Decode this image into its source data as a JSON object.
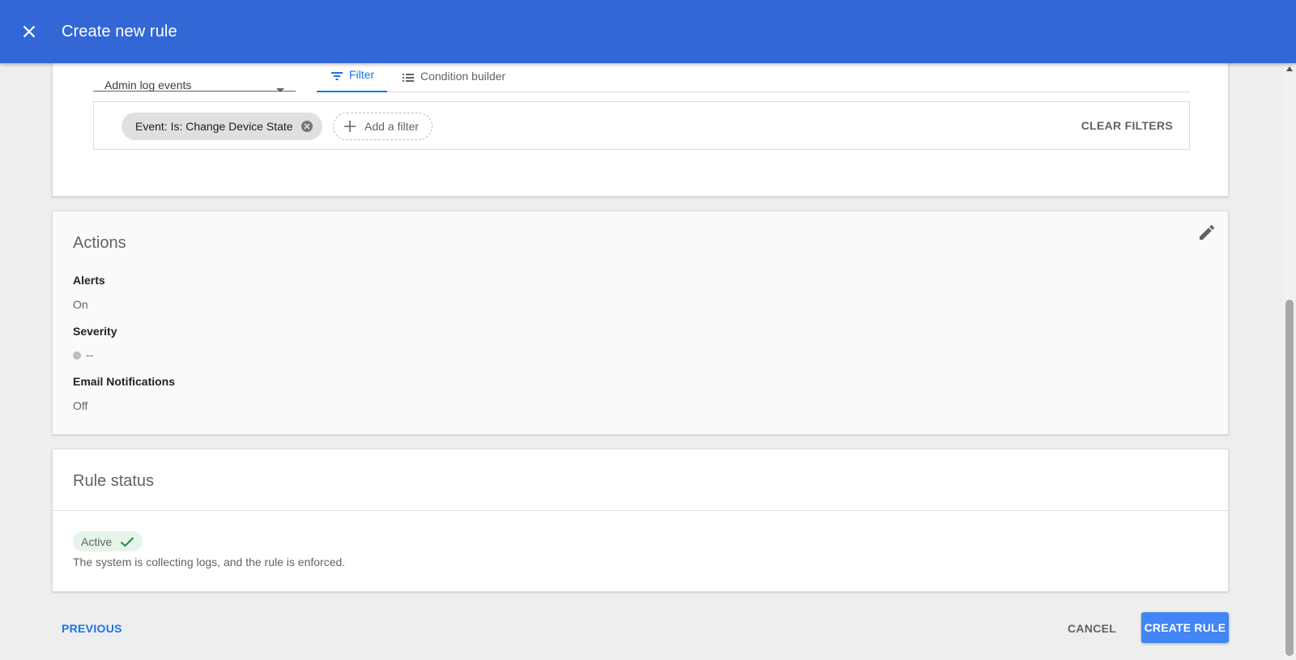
{
  "header": {
    "title": "Create new rule"
  },
  "conditions": {
    "source_select_value": "Admin log events",
    "tabs": [
      {
        "label": "Filter"
      },
      {
        "label": "Condition builder"
      }
    ],
    "filter_chip": "Event: Is: Change Device State",
    "add_filter_label": "Add a filter",
    "clear_filters_label": "CLEAR FILTERS"
  },
  "actions": {
    "title": "Actions",
    "alerts_label": "Alerts",
    "alerts_value": "On",
    "severity_label": "Severity",
    "severity_value": "--",
    "email_label": "Email Notifications",
    "email_value": "Off"
  },
  "rule_status": {
    "title": "Rule status",
    "badge": "Active",
    "description": "The system is collecting logs, and the rule is enforced."
  },
  "footer": {
    "previous_label": "PREVIOUS",
    "cancel_label": "CANCEL",
    "create_label": "CREATE RULE"
  },
  "colors": {
    "appbar": "#3367d6",
    "accent": "#1a73e8",
    "primary_button": "#4285f4",
    "active_badge_bg": "#e6f4ea",
    "active_check": "#1e8e3e"
  }
}
